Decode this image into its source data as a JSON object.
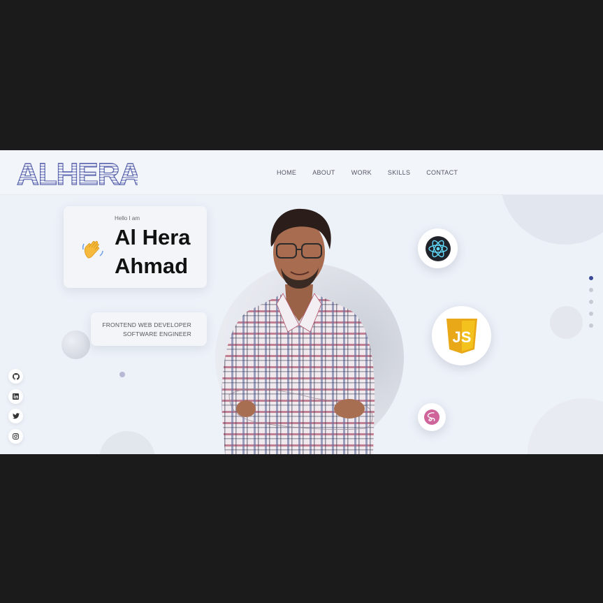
{
  "brand": {
    "logo_text": "ALHERA"
  },
  "nav": {
    "items": [
      "HOME",
      "ABOUT",
      "WORK",
      "SKILLS",
      "CONTACT"
    ]
  },
  "hero": {
    "greeting": "Hello I am",
    "name_line1": "Al Hera",
    "name_line2": "Ahmad",
    "role_line1": "FRONTEND WEB DEVELOPER",
    "role_line2": "SOFTWARE ENGINEER"
  },
  "tech_icons": [
    "react-icon",
    "javascript-icon",
    "sass-icon"
  ],
  "javascript_label": "JS",
  "social_icons": [
    "github-icon",
    "linkedin-icon",
    "twitter-icon",
    "instagram-icon"
  ],
  "section_dots": {
    "count": 5,
    "active_index": 0
  },
  "colors": {
    "accent": "#3b4899",
    "background": "#edf1f8",
    "react": "#61dafb",
    "javascript": "#f0c419",
    "sass": "#cf649a"
  }
}
